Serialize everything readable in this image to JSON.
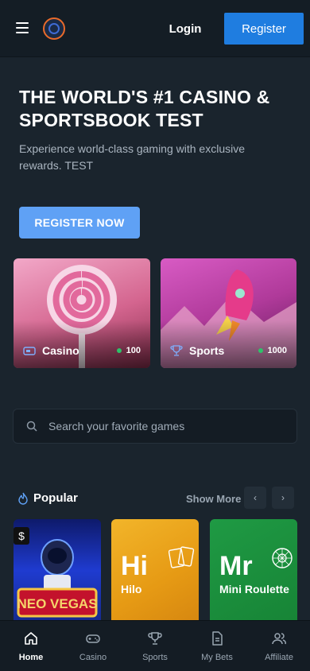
{
  "header": {
    "login_label": "Login",
    "register_label": "Register"
  },
  "hero": {
    "title": "THE WORLD'S #1 CASINO & SPORTSBOOK TEST",
    "subtitle": "Experience world-class gaming with exclusive rewards. TEST",
    "cta_label": "REGISTER NOW"
  },
  "categories": [
    {
      "label": "Casino",
      "count": "100",
      "icon": "casino-icon"
    },
    {
      "label": "Sports",
      "count": "1000",
      "icon": "trophy-icon"
    }
  ],
  "search": {
    "placeholder": "Search your favorite games"
  },
  "popular": {
    "title": "Popular",
    "show_more": "Show More",
    "games": [
      {
        "big": "",
        "name": "NEO VEGAS"
      },
      {
        "big": "Hi",
        "name": "Hilo"
      },
      {
        "big": "Mr",
        "name": "Mini Roulette"
      }
    ]
  },
  "nav": [
    {
      "label": "Home",
      "icon": "home-icon",
      "active": true
    },
    {
      "label": "Casino",
      "icon": "gamepad-icon",
      "active": false
    },
    {
      "label": "Sports",
      "icon": "trophy-icon",
      "active": false
    },
    {
      "label": "My Bets",
      "icon": "document-icon",
      "active": false
    },
    {
      "label": "Affiliate",
      "icon": "users-icon",
      "active": false
    }
  ],
  "colors": {
    "background": "#1a242d",
    "header": "#141d25",
    "register": "#1f7de0",
    "cta": "#5fa1f5",
    "online": "#2ec26a"
  }
}
